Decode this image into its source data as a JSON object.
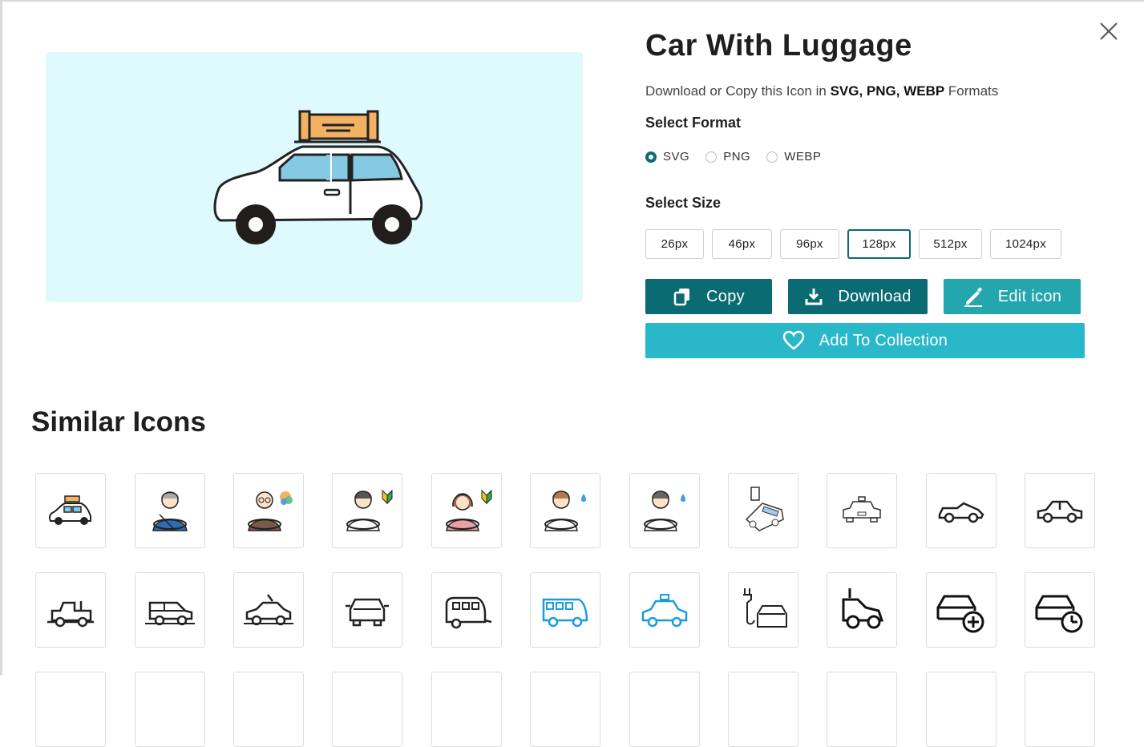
{
  "icon": {
    "title": "Car With Luggage",
    "subtitle_prefix": "Download or Copy this Icon in ",
    "subtitle_formats": "SVG, PNG, WEBP",
    "subtitle_suffix": " Formats"
  },
  "format": {
    "label": "Select Format",
    "options": [
      "SVG",
      "PNG",
      "WEBP"
    ],
    "selected": "SVG"
  },
  "size": {
    "label": "Select Size",
    "options": [
      "26px",
      "46px",
      "96px",
      "128px",
      "512px",
      "1024px"
    ],
    "selected": "128px"
  },
  "actions": {
    "copy": "Copy",
    "download": "Download",
    "edit": "Edit icon",
    "collection": "Add To Collection"
  },
  "similar": {
    "title": "Similar Icons",
    "row1": [
      "car-luggage-color-icon",
      "elderly-man-driving-icon",
      "old-man-driving-senior-mark-icon",
      "boy-driving-beginner-mark-icon",
      "woman-driving-beginner-mark-icon",
      "man-driving-sweat-icon",
      "man-driving-sweat-gray-icon",
      "electric-car-charging-icon",
      "police-car-icon",
      "convertible-car-icon",
      "sedan-car-icon"
    ],
    "row2": [
      "vintage-car-icon",
      "suv-car-icon",
      "taxi-car-icon",
      "car-front-icon",
      "camper-trailer-icon",
      "bus-blue-icon",
      "taxi-blue-icon",
      "ev-charger-car-icon",
      "toy-car-icon",
      "add-car-icon",
      "car-clock-icon"
    ]
  },
  "colors": {
    "primary": "#0a6b73",
    "edit": "#23a6ad",
    "collection": "#29b8c9",
    "preview_bg": "#dffafd",
    "accent_blue": "#1a9ce0"
  }
}
